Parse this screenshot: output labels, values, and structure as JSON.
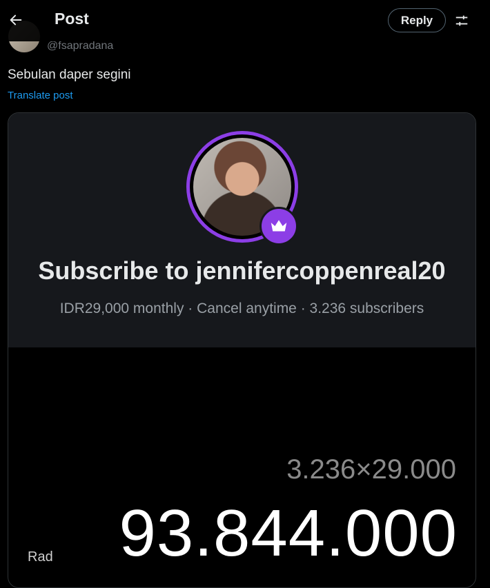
{
  "header": {
    "title": "Post",
    "reply_label": "Reply"
  },
  "tweet": {
    "handle": "@fsapradana",
    "text": "Sebulan daper segini",
    "translate_label": "Translate post"
  },
  "media": {
    "subscribe_title": "Subscribe to jennifercoppenreal20",
    "subscribe_info": "IDR29,000 monthly · Cancel anytime · 3.236 subscribers",
    "calculator": {
      "expression": "3.236×29.000",
      "result": "93.844.000",
      "mode": "Rad"
    }
  },
  "colors": {
    "accent": "#1d9bf0",
    "purple": "#8c3ee6",
    "background": "#000000"
  },
  "icons": [
    "back-arrow-icon",
    "settings-sliders-icon",
    "crown-icon"
  ]
}
